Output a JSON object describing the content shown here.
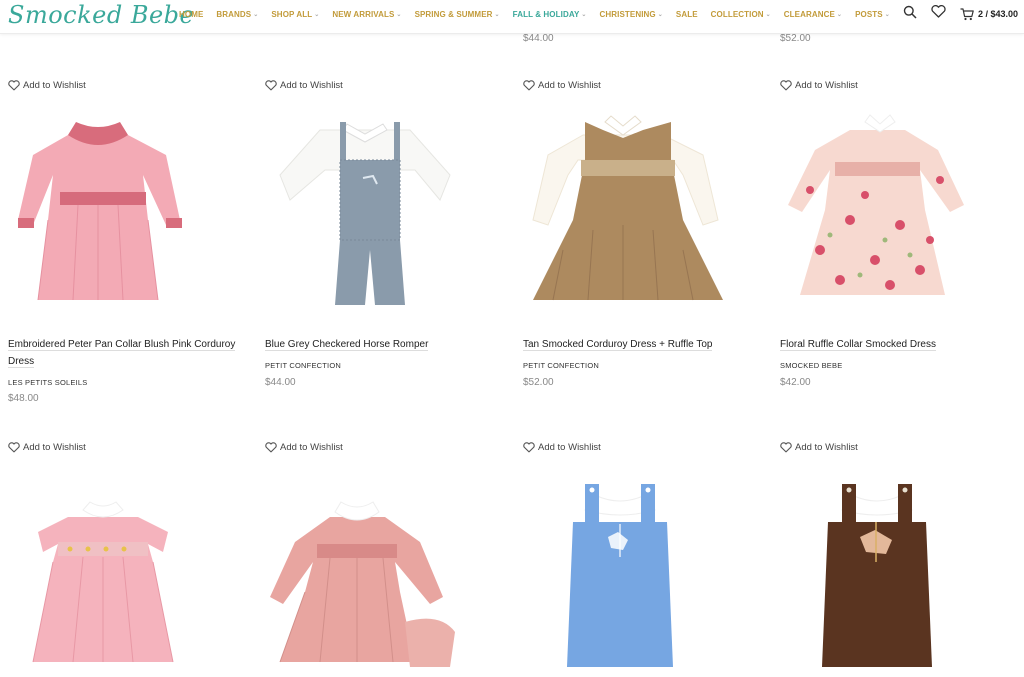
{
  "header": {
    "logo": "Smocked Bebe",
    "nav": [
      {
        "label": "HOME",
        "dropdown": false,
        "active": false
      },
      {
        "label": "BRANDS",
        "dropdown": true,
        "active": false
      },
      {
        "label": "SHOP ALL",
        "dropdown": true,
        "active": false
      },
      {
        "label": "NEW ARRIVALS",
        "dropdown": true,
        "active": false
      },
      {
        "label": "SPRING & SUMMER",
        "dropdown": true,
        "active": false
      },
      {
        "label": "FALL & HOLIDAY",
        "dropdown": true,
        "active": true
      },
      {
        "label": "CHRISTENING",
        "dropdown": true,
        "active": false
      },
      {
        "label": "SALE",
        "dropdown": false,
        "active": false
      },
      {
        "label": "COLLECTION",
        "dropdown": true,
        "active": false
      },
      {
        "label": "CLEARANCE",
        "dropdown": true,
        "active": false
      },
      {
        "label": "POSTS",
        "dropdown": true,
        "active": false
      }
    ],
    "cart": "2 / $43.00",
    "icons": [
      "search-icon",
      "heart-icon",
      "cart-icon"
    ],
    "colors": {
      "nav": "#c29b3a",
      "accent": "#3aa89a"
    }
  },
  "previous_row": {
    "prices": [
      "$44.00",
      "$52.00"
    ]
  },
  "wishlist_label": "Add to Wishlist",
  "products": [
    {
      "title": "Embroidered Peter Pan Collar Blush Pink Corduroy Dress",
      "brand": "LES PETITS SOLEILS",
      "price": "$48.00",
      "image": "pink-dress"
    },
    {
      "title": "Blue Grey Checkered Horse Romper",
      "brand": "PETIT CONFECTION",
      "price": "$44.00",
      "image": "romper"
    },
    {
      "title": "Tan Smocked Corduroy Dress + Ruffle Top",
      "brand": "PETIT CONFECTION",
      "price": "$52.00",
      "image": "tan-dress"
    },
    {
      "title": "Floral Ruffle Collar Smocked Dress",
      "brand": "SMOCKED BEBE",
      "price": "$42.00",
      "image": "floral-dress"
    },
    {
      "image": "pink-smocked-dress"
    },
    {
      "image": "pink-dress-bloomers"
    },
    {
      "image": "blue-jon-jon"
    },
    {
      "image": "brown-jon-jon"
    }
  ]
}
